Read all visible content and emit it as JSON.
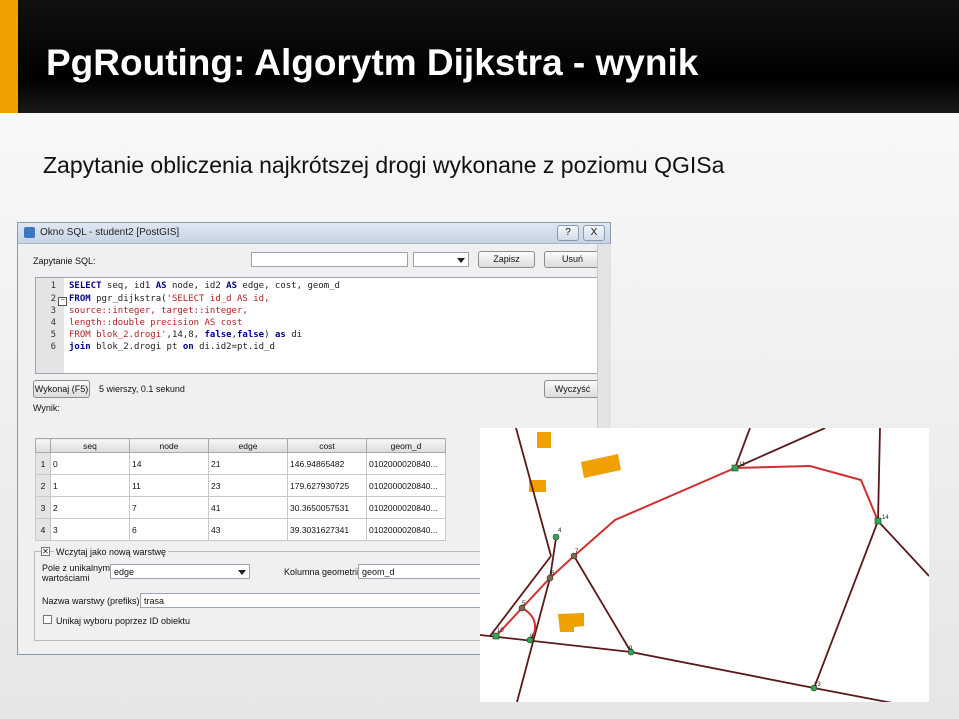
{
  "slide": {
    "title": "PgRouting: Algorytm Dijkstra - wynik",
    "subtitle": "Zapytanie obliczenia najkrótszej drogi wykonane z poziomu QGISa",
    "accent_color": "#f0a000"
  },
  "window": {
    "title": "Okno SQL - student2 [PostGIS]",
    "help_label": "?",
    "close_label": "X"
  },
  "query": {
    "label": "Zapytanie SQL:",
    "name_value": "",
    "save_label": "Zapisz",
    "delete_label": "Usuń",
    "lines": [
      {
        "num": "1"
      },
      {
        "num": "2"
      },
      {
        "num": "3"
      },
      {
        "num": "4"
      },
      {
        "num": "5"
      },
      {
        "num": "6"
      }
    ],
    "code": {
      "l1_k1": "SELECT",
      "l1_t1": " seq, id1 ",
      "l1_k2": "AS",
      "l1_t2": " node, id2 ",
      "l1_k3": "AS",
      "l1_t3": " edge, cost, geom_d",
      "l2_k1": "FROM",
      "l2_t1": " pgr_dijkstra(",
      "l2_s1": "'SELECT id_d AS id,",
      "l3_s1": "source::integer, target::integer,",
      "l4_s1": "length::double precision AS cost",
      "l5_s1": "FROM blok_2.drogi'",
      "l5_t1": ",14,8, ",
      "l5_k1": "false",
      "l5_t2": ",",
      "l5_k2": "false",
      "l5_t3": ") ",
      "l5_k3": "as",
      "l5_t4": " di",
      "l6_k1": "join",
      "l6_t1": " blok_2.drogi  pt ",
      "l6_k2": "on",
      "l6_t2": " di.id2=pt.id_d"
    }
  },
  "execute": {
    "button_label": "Wykonaj (F5)",
    "status": "5 wierszy, 0.1 sekund",
    "clear_label": "Wyczyść"
  },
  "results": {
    "label": "Wynik:",
    "columns": [
      "seq",
      "node",
      "edge",
      "cost",
      "geom_d"
    ],
    "rows": [
      {
        "rn": "1",
        "seq": "0",
        "node": "14",
        "edge": "21",
        "cost": "146.94865482",
        "geom": "0102000020840..."
      },
      {
        "rn": "2",
        "seq": "1",
        "node": "11",
        "edge": "23",
        "cost": "179.627930725",
        "geom": "0102000020840..."
      },
      {
        "rn": "3",
        "seq": "2",
        "node": "7",
        "edge": "41",
        "cost": "30.3650057531",
        "geom": "0102000020840..."
      },
      {
        "rn": "4",
        "seq": "3",
        "node": "6",
        "edge": "43",
        "cost": "39.3031627341",
        "geom": "0102000020840..."
      }
    ]
  },
  "layer": {
    "checkbox_label": "Wczytaj jako nową warstwę",
    "unique_label_1": "Pole z unikalnymi",
    "unique_label_2": "wartościami",
    "unique_value": "edge",
    "geom_label": "Kolumna geometrii",
    "geom_value": "geom_d",
    "prefix_label": "Nazwa warstwy (prefiks)",
    "prefix_value": "trasa",
    "avoid_label": "Unikaj wyboru poprzez ID obiektu"
  },
  "map": {
    "road_color": "#5a1a1a",
    "route_color": "#d03030",
    "building_color": "#f0a000",
    "node_color": "#2fa84f",
    "nodes": [
      {
        "id": "n11",
        "label": "11"
      },
      {
        "id": "n14",
        "label": "14"
      },
      {
        "id": "n4",
        "label": "4"
      },
      {
        "id": "n7",
        "label": "7"
      },
      {
        "id": "n6",
        "label": "6"
      },
      {
        "id": "n5",
        "label": "5"
      },
      {
        "id": "n8",
        "label": "8"
      },
      {
        "id": "n9",
        "label": "9"
      },
      {
        "id": "n13",
        "label": "13"
      },
      {
        "id": "n10",
        "label": "10"
      }
    ]
  }
}
